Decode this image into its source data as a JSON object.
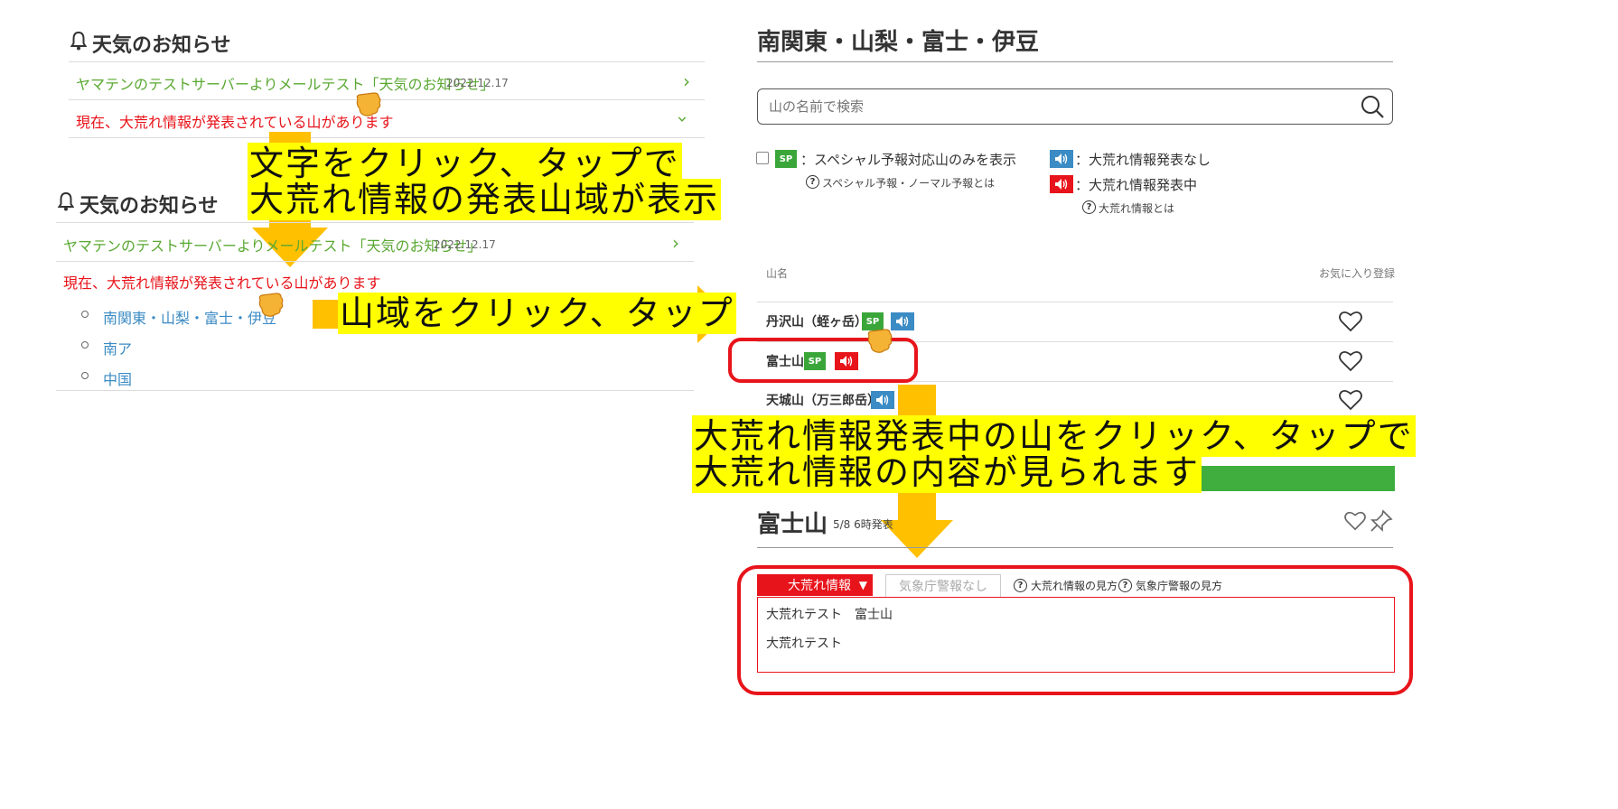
{
  "left": {
    "top_notice": {
      "title": "天気のお知らせ",
      "mail_test_link": "ヤマテンのテストサーバーよりメールテスト「天気のお知らせ」",
      "date": "2022.12.17",
      "alert_text": "現在、大荒れ情報が発表されている山があります"
    },
    "bottom_notice": {
      "title": "天気のお知らせ",
      "mail_test_link": "ヤマテンのテストサーバーよりメールテスト「天気のお知らせ」",
      "date": "2022.12.17",
      "alert_text": "現在、大荒れ情報が発表されている山があります",
      "regions": [
        "南関東・山梨・富士・伊豆",
        "南ア",
        "中国"
      ]
    }
  },
  "callouts": {
    "step1_line1": "文字をクリック、タップで",
    "step1_line2": "大荒れ情報の発表山域が表示",
    "step2": "山域をクリック、タップ",
    "step3_line1": "大荒れ情報発表中の山をクリック、タップで",
    "step3_line2": "大荒れ情報の内容が見られます"
  },
  "right": {
    "region_title": "南関東・山梨・富士・伊豆",
    "search": {
      "placeholder": "山の名前で検索"
    },
    "legend": {
      "sp_badge": "SP",
      "sp_only_label": "：スペシャル予報対応山のみを表示",
      "sp_help": "スペシャル予報・ノーマル予報とは",
      "no_alert_label": "：大荒れ情報発表なし",
      "alert_label": "：大荒れ情報発表中",
      "alert_help": "大荒れ情報とは"
    },
    "table": {
      "col_name": "山名",
      "col_fav": "お気に入り登録",
      "rows": [
        {
          "name": "丹沢山（蛭ヶ岳）",
          "sp": true,
          "alert": false
        },
        {
          "name": "富士山",
          "sp": true,
          "alert": true
        },
        {
          "name": "天城山（万三郎岳）",
          "sp": false,
          "alert": false
        }
      ]
    },
    "detail": {
      "mountain": "富士山",
      "issued": "5/8 6時発表",
      "tab_alert": "大荒れ情報",
      "tab_jma": "気象庁警報なし",
      "help_alert": "大荒れ情報の見方",
      "help_jma": "気象庁警報の見方",
      "content_line1": "大荒れテスト　富士山",
      "content_line2": "大荒れテスト"
    }
  },
  "colors": {
    "green": "#5aa832",
    "red": "#e8141b",
    "blue": "#3b8bc4",
    "callout_yellow": "#ffff00",
    "arrow_orange": "#ffc000"
  }
}
